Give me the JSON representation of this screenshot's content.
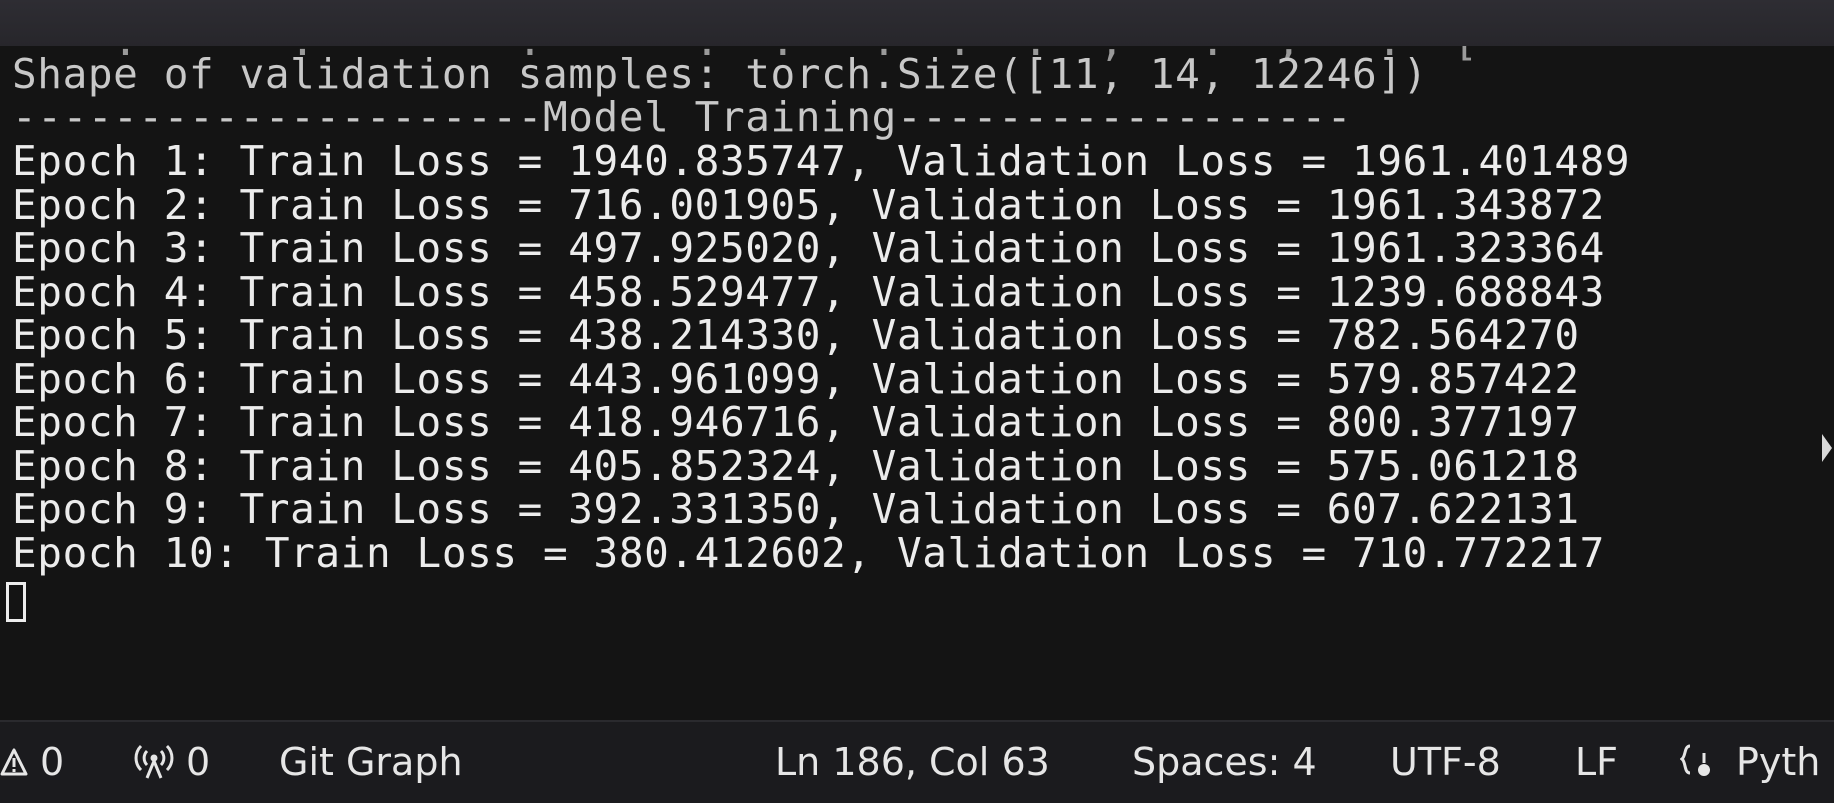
{
  "terminal": {
    "clipped_line": "    .      .        .      .  .   .  .  .  ,   .  ,   .  [",
    "shape_line": "Shape of validation samples: torch.Size([11, 14, 12246])",
    "section_header": "---------------------Model Training------------------",
    "epochs": [
      "Epoch 1: Train Loss = 1940.835747, Validation Loss = 1961.401489",
      "Epoch 2: Train Loss = 716.001905, Validation Loss = 1961.343872",
      "Epoch 3: Train Loss = 497.925020, Validation Loss = 1961.323364",
      "Epoch 4: Train Loss = 458.529477, Validation Loss = 1239.688843",
      "Epoch 5: Train Loss = 438.214330, Validation Loss = 782.564270",
      "Epoch 6: Train Loss = 443.961099, Validation Loss = 579.857422",
      "Epoch 7: Train Loss = 418.946716, Validation Loss = 800.377197",
      "Epoch 8: Train Loss = 405.852324, Validation Loss = 575.061218",
      "Epoch 9: Train Loss = 392.331350, Validation Loss = 607.622131",
      "Epoch 10: Train Loss = 380.412602, Validation Loss = 710.772217"
    ]
  },
  "statusbar": {
    "warnings_icon": "warning-icon",
    "warnings_count": "0",
    "ports_icon": "broadcast-icon",
    "ports_count": "0",
    "git_graph": "Git Graph",
    "cursor_position": "Ln 186, Col 63",
    "indentation": "Spaces: 4",
    "encoding": "UTF-8",
    "line_ending": "LF",
    "language_icon": "braces-icon",
    "language": "Pyth"
  },
  "colors": {
    "terminal_bg": "#141414",
    "terminal_fg": "#ececec",
    "statusbar_bg": "#1b1b1e"
  }
}
